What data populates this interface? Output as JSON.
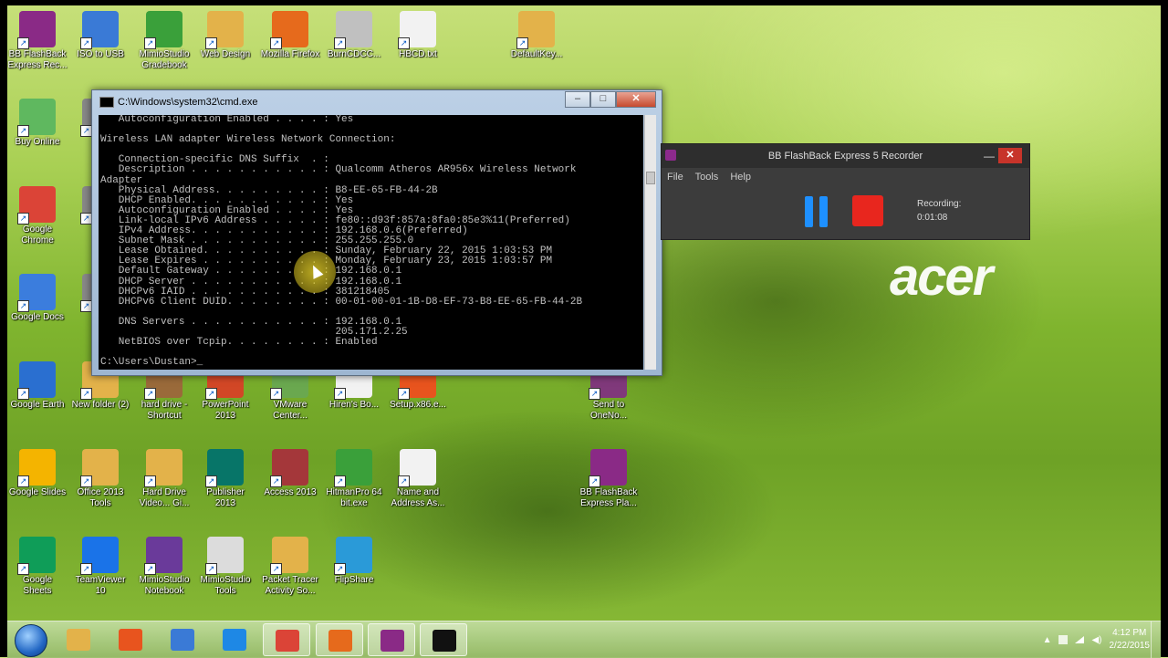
{
  "desktop_icons": [
    {
      "label": "BB FlashBack Express Rec...",
      "icon": "video-recorder-icon",
      "color": "#8a2a86"
    },
    {
      "label": "ISO to USB",
      "icon": "usb-icon",
      "color": "#3a7ad6"
    },
    {
      "label": "MimioStudio Gradebook",
      "icon": "gradebook-icon",
      "color": "#3aa03a"
    },
    {
      "label": "Web Design",
      "icon": "folder-icon",
      "color": "#e3b24a"
    },
    {
      "label": "Mozilla Firefox",
      "icon": "firefox-icon",
      "color": "#e66a1c"
    },
    {
      "label": "BurnCDCC...",
      "icon": "disc-icon",
      "color": "#c0c0c0"
    },
    {
      "label": "HBCD.txt",
      "icon": "text-file-icon",
      "color": "#f2f2f2"
    },
    {
      "label": "DefaultKey...",
      "icon": "folder-icon",
      "color": "#e3b24a"
    },
    {
      "label": "Buy Online",
      "icon": "acer-shop-icon",
      "color": "#5fb85f"
    },
    {
      "label": "Ha",
      "icon": "generic-icon",
      "color": "#888888"
    },
    {
      "label": "Google Chrome",
      "icon": "chrome-icon",
      "color": "#db4437"
    },
    {
      "label": "h",
      "icon": "generic-icon",
      "color": "#888888"
    },
    {
      "label": "Google Docs",
      "icon": "google-docs-icon",
      "color": "#3b7ddd"
    },
    {
      "label": "Ne",
      "icon": "generic-icon",
      "color": "#888888"
    },
    {
      "label": "Google Earth",
      "icon": "google-earth-icon",
      "color": "#2a6fd0"
    },
    {
      "label": "New folder (2)",
      "icon": "folder-icon",
      "color": "#e3b24a"
    },
    {
      "label": "hard drive - Shortcut",
      "icon": "hard-drive-icon",
      "color": "#9a6a3a"
    },
    {
      "label": "PowerPoint 2013",
      "icon": "powerpoint-icon",
      "color": "#d24726"
    },
    {
      "label": "VMware Center...",
      "icon": "vmware-icon",
      "color": "#6aa84f"
    },
    {
      "label": "Hiren's Bo...",
      "icon": "document-icon",
      "color": "#f2f2f2"
    },
    {
      "label": "Setup.x86.e...",
      "icon": "office-setup-icon",
      "color": "#e8541e"
    },
    {
      "label": "Send to OneNo...",
      "icon": "onenote-icon",
      "color": "#80397b"
    },
    {
      "label": "Google Slides",
      "icon": "google-slides-icon",
      "color": "#f4b400"
    },
    {
      "label": "Office 2013 Tools",
      "icon": "folder-icon",
      "color": "#e3b24a"
    },
    {
      "label": "Hard Drive Video... Gi...",
      "icon": "folder-icon",
      "color": "#e3b24a"
    },
    {
      "label": "Publisher 2013",
      "icon": "publisher-icon",
      "color": "#077568"
    },
    {
      "label": "Access 2013",
      "icon": "access-icon",
      "color": "#a4373a"
    },
    {
      "label": "HitmanPro 64 bit.exe",
      "icon": "hitmanpro-icon",
      "color": "#3aa03a"
    },
    {
      "label": "Name and Address As...",
      "icon": "pdf-icon",
      "color": "#f2f2f2"
    },
    {
      "label": "BB FlashBack Express Pla...",
      "icon": "video-player-icon",
      "color": "#8a2a86"
    },
    {
      "label": "Google Sheets",
      "icon": "google-sheets-icon",
      "color": "#0f9d58"
    },
    {
      "label": "TeamViewer 10",
      "icon": "teamviewer-icon",
      "color": "#1a73e8"
    },
    {
      "label": "MimioStudio Notebook",
      "icon": "notebook-icon",
      "color": "#6a3a9a"
    },
    {
      "label": "MimioStudio Tools",
      "icon": "pen-tools-icon",
      "color": "#dcdcdc"
    },
    {
      "label": "Packet Tracer Activity So...",
      "icon": "folder-icon",
      "color": "#e3b24a"
    },
    {
      "label": "FlipShare",
      "icon": "flipshare-icon",
      "color": "#2a9ad8"
    }
  ],
  "cmd": {
    "title": "C:\\Windows\\system32\\cmd.exe",
    "lines": [
      "   Autoconfiguration Enabled . . . . : Yes",
      "",
      "Wireless LAN adapter Wireless Network Connection:",
      "",
      "   Connection-specific DNS Suffix  . :",
      "   Description . . . . . . . . . . . : Qualcomm Atheros AR956x Wireless Network",
      "Adapter",
      "   Physical Address. . . . . . . . . : B8-EE-65-FB-44-2B",
      "   DHCP Enabled. . . . . . . . . . . : Yes",
      "   Autoconfiguration Enabled . . . . : Yes",
      "   Link-local IPv6 Address . . . . . : fe80::d93f:857a:8fa0:85e3%11(Preferred)",
      "   IPv4 Address. . . . . . . . . . . : 192.168.0.6(Preferred)",
      "   Subnet Mask . . . . . . . . . . . : 255.255.255.0",
      "   Lease Obtained. . . . . . . . . . : Sunday, February 22, 2015 1:03:53 PM",
      "   Lease Expires . . . . . . . . . . : Monday, February 23, 2015 1:03:57 PM",
      "   Default Gateway . . . . . . . . . : 192.168.0.1",
      "   DHCP Server . . . . . . . . . . . : 192.168.0.1",
      "   DHCPv6 IAID . . . . . . . . . . . : 381218405",
      "   DHCPv6 Client DUID. . . . . . . . : 00-01-00-01-1B-D8-EF-73-B8-EE-65-FB-44-2B",
      "",
      "   DNS Servers . . . . . . . . . . . : 192.168.0.1",
      "                                       205.171.2.25",
      "   NetBIOS over Tcpip. . . . . . . . : Enabled",
      "",
      "C:\\Users\\Dustan>_"
    ]
  },
  "recorder": {
    "title": "BB FlashBack Express 5 Recorder",
    "menu": [
      "File",
      "Tools",
      "Help"
    ],
    "status_label": "Recording:",
    "elapsed": "0:01:08",
    "close_glyph": "✕",
    "minimize_glyph": "—"
  },
  "brand": {
    "watermark": "acer"
  },
  "taskbar": {
    "pinned": [
      {
        "name": "file-explorer",
        "icon": "folder-icon",
        "color": "#e3b24a"
      },
      {
        "name": "media-player",
        "icon": "media-player-icon",
        "color": "#e8541e"
      },
      {
        "name": "paint-tool",
        "icon": "paint-icon",
        "color": "#3a7ad6"
      },
      {
        "name": "internet-explorer",
        "icon": "internet-explorer-icon",
        "color": "#1e88e5"
      },
      {
        "name": "chrome",
        "icon": "chrome-icon",
        "color": "#db4437"
      },
      {
        "name": "firefox",
        "icon": "firefox-icon",
        "color": "#e66a1c"
      },
      {
        "name": "flashback-recorder",
        "icon": "video-recorder-icon",
        "color": "#8a2a86"
      },
      {
        "name": "command-prompt",
        "icon": "cmd-icon",
        "color": "#111111"
      }
    ],
    "time": "4:12 PM",
    "date": "2/22/2015"
  }
}
